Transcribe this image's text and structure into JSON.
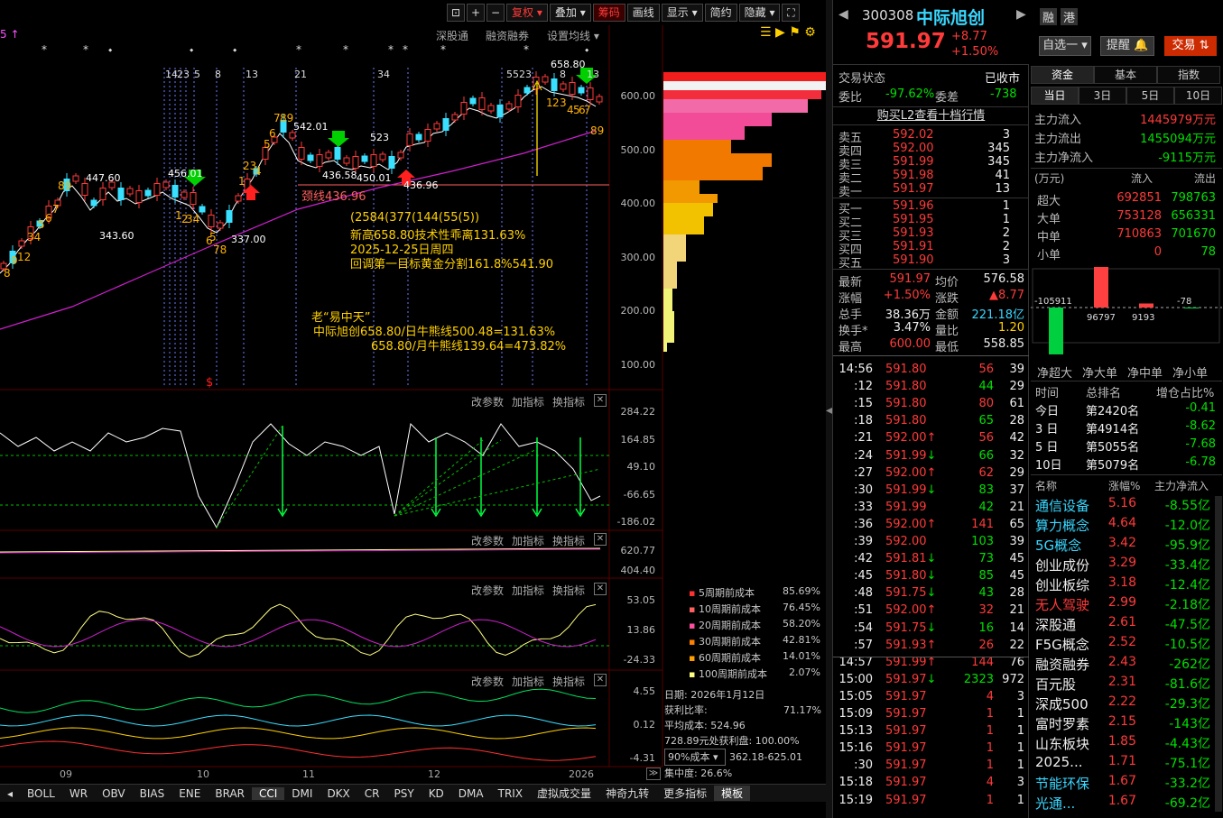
{
  "stock": {
    "code": "300308",
    "name": "中际旭创",
    "price": "591.97",
    "change": "+8.77",
    "pct": "+1.50%",
    "tag1": "融",
    "tag2": "港"
  },
  "toolbar": {
    "fuquan": "复权",
    "diejia": "叠加",
    "chouma": "筹码",
    "huaxian": "画线",
    "xianshi": "显示",
    "jianyue": "简约",
    "yincang": "隐藏",
    "plus": "+",
    "minus": "−",
    "lock": "⊡",
    "full": "⛶"
  },
  "subbar": {
    "indicator": "5 ↑",
    "shengutong": "深股通",
    "rongzi": "融资融券",
    "junxian": "设置均线"
  },
  "pane_controls": {
    "gai": "改参数",
    "jia": "加指标",
    "huan": "换指标",
    "close": "✕"
  },
  "price_axis": [
    "600.00",
    "500.00",
    "400.00",
    "300.00",
    "200.00",
    "100.00"
  ],
  "cci_axis": [
    "284.22",
    "164.85",
    "49.10",
    "-66.65",
    "-186.02"
  ],
  "vol_axis": [
    "620.77",
    "404.40"
  ],
  "ind3_axis": [
    "53.05",
    "13.86",
    "-24.33"
  ],
  "ind4_axis": [
    "4.55",
    "0.12",
    "-4.31"
  ],
  "date_axis": [
    "09",
    "10",
    "11",
    "12",
    "2026"
  ],
  "annotations": {
    "high": "658.80",
    "p1": "447.60",
    "p2": "456.01",
    "p3": "343.60",
    "p4": "337.00",
    "p5": "542.01",
    "p6": "436.58",
    "p7": "450.01",
    "p8": "436.96",
    "p9": "523",
    "neck": "颈线436.96",
    "note1": "(2584(377(144(55(5))",
    "note2": "新高658.80技术性乖离131.63%",
    "note3": "2025-12-25日周四",
    "note4": "回调第一目标黄金分割161.8%541.90",
    "note5": "老“易中天”",
    "note6": "中际旭创658.80/日牛熊线500.48=131.63%",
    "note7": "658.80/月牛熊线139.64=473.82%",
    "top_nums": [
      "14",
      "23",
      "5",
      "8",
      "13",
      "21",
      "34",
      "55",
      "23",
      "8",
      "13"
    ],
    "s_mark": "$"
  },
  "cost": {
    "rows": [
      {
        "label": "5周期前成本",
        "value": "85.69%",
        "color": "#ff3030"
      },
      {
        "label": "10周期前成本",
        "value": "76.45%",
        "color": "#ff6060"
      },
      {
        "label": "20周期前成本",
        "value": "58.20%",
        "color": "#ff50a0"
      },
      {
        "label": "30周期前成本",
        "value": "42.81%",
        "color": "#ff8000"
      },
      {
        "label": "60周期前成本",
        "value": "14.01%",
        "color": "#ffa000"
      },
      {
        "label": "100周期前成本",
        "value": "2.07%",
        "color": "#ffff80"
      }
    ],
    "date": "日期: 2026年1月12日",
    "profit_label": "获利比率:",
    "profit": "71.17%",
    "avg": "平均成本: 524.96",
    "line4": "728.89元处获利盘: 100.00%",
    "select": "90%成本",
    "range": "362.18-625.01",
    "conc": "集中度: 26.6%"
  },
  "bottom_tabs": [
    "BOLL",
    "WR",
    "OBV",
    "BIAS",
    "ENE",
    "BRAR",
    "CCI",
    "DMI",
    "DKX",
    "CR",
    "PSY",
    "KD",
    "DMA",
    "TRIX",
    "虚拟成交量",
    "神奇九转",
    "更多指标",
    "模板"
  ],
  "right": {
    "zixuan": "自选一",
    "tixing": "提醒",
    "jiaoyi": "交易",
    "state_label": "交易状态",
    "state": "已收市",
    "weibi_label": "委比",
    "weibi": "-97.62%",
    "weicha_label": "委差",
    "weicha": "-738",
    "l2": "购买L2查看十档行情",
    "sell": [
      {
        "l": "卖五",
        "p": "592.02",
        "v": "3"
      },
      {
        "l": "卖四",
        "p": "592.00",
        "v": "345"
      },
      {
        "l": "卖三",
        "p": "591.99",
        "v": "345"
      },
      {
        "l": "卖二",
        "p": "591.98",
        "v": "41"
      },
      {
        "l": "卖一",
        "p": "591.97",
        "v": "13"
      }
    ],
    "buy": [
      {
        "l": "买一",
        "p": "591.96",
        "v": "1"
      },
      {
        "l": "买二",
        "p": "591.95",
        "v": "1"
      },
      {
        "l": "买三",
        "p": "591.93",
        "v": "2"
      },
      {
        "l": "买四",
        "p": "591.91",
        "v": "2"
      },
      {
        "l": "买五",
        "p": "591.90",
        "v": "3"
      }
    ],
    "stats": [
      {
        "a": "最新",
        "av": "591.97",
        "ac": "red",
        "b": "均价",
        "bv": "576.58",
        "bc": "wht"
      },
      {
        "a": "涨幅",
        "av": "+1.50%",
        "ac": "red",
        "b": "涨跌",
        "bv": "▲8.77",
        "bc": "red"
      },
      {
        "a": "总手",
        "av": "38.36万",
        "ac": "wht",
        "b": "金额",
        "bv": "221.18亿",
        "bc": "cyn"
      },
      {
        "a": "换手*",
        "av": "3.47%",
        "ac": "wht",
        "b": "量比",
        "bv": "1.20",
        "bc": "yel"
      },
      {
        "a": "最高",
        "av": "600.00",
        "ac": "red",
        "b": "最低",
        "bv": "558.85",
        "bc": "wht"
      }
    ],
    "ticks": [
      {
        "t": "14:56",
        "p": "591.80",
        "a": "",
        "v": "56",
        "n": "39",
        "vc": "red"
      },
      {
        "t": ":12",
        "p": "591.80",
        "a": "",
        "v": "44",
        "n": "29",
        "vc": "grn"
      },
      {
        "t": ":15",
        "p": "591.80",
        "a": "",
        "v": "80",
        "n": "61",
        "vc": "red"
      },
      {
        "t": ":18",
        "p": "591.80",
        "a": "",
        "v": "65",
        "n": "28",
        "vc": "grn"
      },
      {
        "t": ":21",
        "p": "592.00",
        "a": "up",
        "v": "56",
        "n": "42",
        "vc": "red"
      },
      {
        "t": ":24",
        "p": "591.99",
        "a": "dn",
        "v": "66",
        "n": "32",
        "vc": "grn"
      },
      {
        "t": ":27",
        "p": "592.00",
        "a": "up",
        "v": "62",
        "n": "29",
        "vc": "red"
      },
      {
        "t": ":30",
        "p": "591.99",
        "a": "dn",
        "v": "83",
        "n": "37",
        "vc": "grn"
      },
      {
        "t": ":33",
        "p": "591.99",
        "a": "",
        "v": "42",
        "n": "21",
        "vc": "grn"
      },
      {
        "t": ":36",
        "p": "592.00",
        "a": "up",
        "v": "141",
        "n": "65",
        "vc": "red"
      },
      {
        "t": ":39",
        "p": "592.00",
        "a": "",
        "v": "103",
        "n": "39",
        "vc": "grn"
      },
      {
        "t": ":42",
        "p": "591.81",
        "a": "dn",
        "v": "73",
        "n": "45",
        "vc": "grn"
      },
      {
        "t": ":45",
        "p": "591.80",
        "a": "dn",
        "v": "85",
        "n": "45",
        "vc": "grn"
      },
      {
        "t": ":48",
        "p": "591.75",
        "a": "dn",
        "v": "43",
        "n": "28",
        "vc": "grn"
      },
      {
        "t": ":51",
        "p": "592.00",
        "a": "up",
        "v": "32",
        "n": "21",
        "vc": "red"
      },
      {
        "t": ":54",
        "p": "591.75",
        "a": "dn",
        "v": "16",
        "n": "14",
        "vc": "grn"
      },
      {
        "t": ":57",
        "p": "591.93",
        "a": "up",
        "v": "26",
        "n": "22",
        "vc": "red"
      },
      {
        "t": "14:57",
        "p": "591.99",
        "a": "up",
        "v": "144",
        "n": "76",
        "vc": "red"
      },
      {
        "t": "15:00",
        "p": "591.97",
        "a": "dn",
        "v": "2323",
        "n": "972",
        "vc": "grn"
      },
      {
        "t": "15:05",
        "p": "591.97",
        "a": "",
        "v": "4",
        "n": "3",
        "vc": "red"
      },
      {
        "t": "15:09",
        "p": "591.97",
        "a": "",
        "v": "1",
        "n": "1",
        "vc": "red"
      },
      {
        "t": "15:13",
        "p": "591.97",
        "a": "",
        "v": "1",
        "n": "1",
        "vc": "red"
      },
      {
        "t": "15:16",
        "p": "591.97",
        "a": "",
        "v": "1",
        "n": "1",
        "vc": "red"
      },
      {
        "t": ":30",
        "p": "591.97",
        "a": "",
        "v": "1",
        "n": "1",
        "vc": "red"
      },
      {
        "t": "15:18",
        "p": "591.97",
        "a": "",
        "v": "4",
        "n": "3",
        "vc": "red"
      },
      {
        "t": "15:19",
        "p": "591.97",
        "a": "",
        "v": "1",
        "n": "1",
        "vc": "red"
      }
    ],
    "fund_tabs": [
      "资金",
      "基本",
      "指数"
    ],
    "day_tabs": [
      "当日",
      "3日",
      "5日",
      "10日"
    ],
    "flow": [
      {
        "l": "主力流入",
        "v": "1445979万元",
        "c": "red"
      },
      {
        "l": "主力流出",
        "v": "1455094万元",
        "c": "grn"
      },
      {
        "l": "主力净流入",
        "v": "-9115万元",
        "c": "grn"
      }
    ],
    "flow_head": {
      "unit": "(万元)",
      "in": "流入",
      "out": "流出"
    },
    "flow_rows": [
      {
        "l": "超大",
        "i": "692851",
        "o": "798763"
      },
      {
        "l": "大单",
        "i": "753128",
        "o": "656331"
      },
      {
        "l": "中单",
        "i": "710863",
        "o": "701670"
      },
      {
        "l": "小单",
        "i": "0",
        "o": "78"
      }
    ],
    "bar_vals": [
      {
        "v": "-105911",
        "n": -105911
      },
      {
        "v": "96797",
        "n": 96797
      },
      {
        "v": "9193",
        "n": 9193
      },
      {
        "v": "-78",
        "n": -78
      }
    ],
    "bar_labels": [
      "净超大",
      "净大单",
      "净中单",
      "净小单"
    ],
    "rank_head": {
      "a": "时间",
      "b": "总排名",
      "c": "增仓占比%"
    },
    "rank": [
      {
        "a": "今日",
        "b": "第2420名",
        "c": "-0.41"
      },
      {
        "a": "3 日",
        "b": "第4914名",
        "c": "-8.62"
      },
      {
        "a": "5 日",
        "b": "第5055名",
        "c": "-7.68"
      },
      {
        "a": "10日",
        "b": "第5079名",
        "c": "-6.78"
      }
    ],
    "sector_head": {
      "a": "名称",
      "b": "涨幅%",
      "c": "主力净流入"
    },
    "sectors": [
      {
        "n": "通信设备",
        "p": "5.16",
        "f": "-8.55亿",
        "c": "cyn"
      },
      {
        "n": "算力概念",
        "p": "4.64",
        "f": "-12.0亿",
        "c": "cyn"
      },
      {
        "n": "5G概念",
        "p": "3.42",
        "f": "-95.9亿",
        "c": "cyn"
      },
      {
        "n": "创业成份",
        "p": "3.29",
        "f": "-33.4亿",
        "c": "wht"
      },
      {
        "n": "创业板综",
        "p": "3.18",
        "f": "-12.4亿",
        "c": "wht"
      },
      {
        "n": "无人驾驶",
        "p": "2.99",
        "f": "-2.18亿",
        "c": "red"
      },
      {
        "n": "深股通",
        "p": "2.61",
        "f": "-47.5亿",
        "c": "wht"
      },
      {
        "n": "F5G概念",
        "p": "2.52",
        "f": "-10.5亿",
        "c": "wht"
      },
      {
        "n": "融资融券",
        "p": "2.43",
        "f": "-262亿",
        "c": "wht"
      },
      {
        "n": "百元股",
        "p": "2.31",
        "f": "-81.6亿",
        "c": "wht"
      },
      {
        "n": "深成500",
        "p": "2.22",
        "f": "-29.3亿",
        "c": "wht"
      },
      {
        "n": "富时罗素",
        "p": "2.15",
        "f": "-143亿",
        "c": "wht"
      },
      {
        "n": "山东板块",
        "p": "1.85",
        "f": "-4.43亿",
        "c": "wht"
      },
      {
        "n": "2025...",
        "p": "1.71",
        "f": "-75.1亿",
        "c": "wht"
      },
      {
        "n": "节能环保",
        "p": "1.67",
        "f": "-33.2亿",
        "c": "cyn"
      },
      {
        "n": "光通...",
        "p": "1.67",
        "f": "-69.2亿",
        "c": "cyn"
      }
    ]
  }
}
